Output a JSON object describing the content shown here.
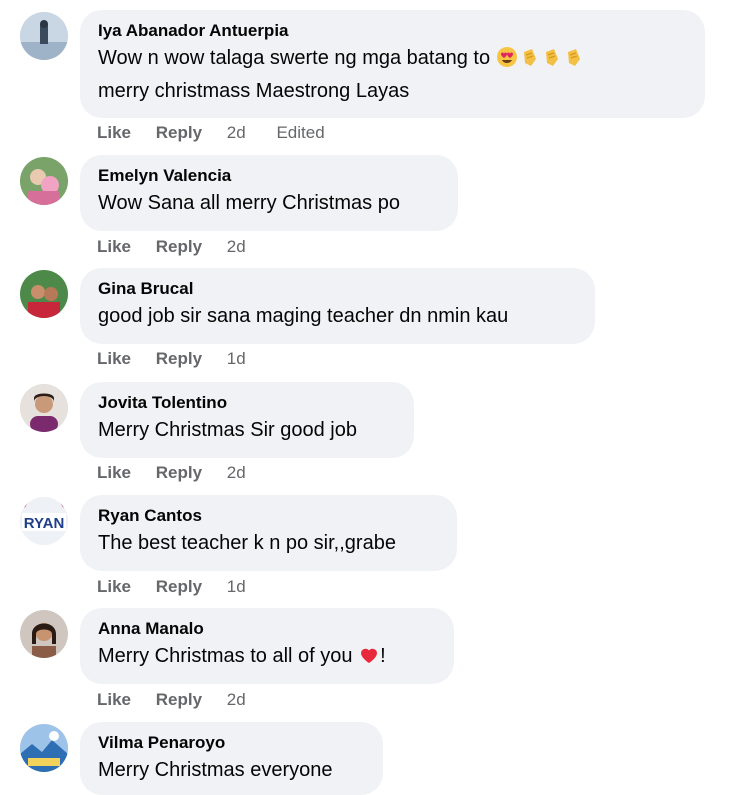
{
  "comments": [
    {
      "author": "Iya Abanador Antuerpia",
      "line1": "Wow n wow talaga swerte ng mga batang to",
      "line2": "merry christmass Maestrong Layas",
      "like": "Like",
      "reply": "Reply",
      "time": "2d",
      "edited": "Edited",
      "emojis": [
        "heart-eyes-emoji",
        "clapping-hands-emoji",
        "clapping-hands-emoji",
        "clapping-hands-emoji"
      ]
    },
    {
      "author": "Emelyn Valencia",
      "text": "Wow Sana all merry Christmas po",
      "like": "Like",
      "reply": "Reply",
      "time": "2d"
    },
    {
      "author": "Gina Brucal",
      "text": "good job sir sana maging teacher dn nmin kau",
      "like": "Like",
      "reply": "Reply",
      "time": "1d"
    },
    {
      "author": "Jovita Tolentino",
      "text": "Merry Christmas Sir good job",
      "like": "Like",
      "reply": "Reply",
      "time": "2d"
    },
    {
      "author": "Ryan Cantos",
      "avatar_text": "RYAN",
      "text": "The best teacher k n po sir,,grabe",
      "like": "Like",
      "reply": "Reply",
      "time": "1d"
    },
    {
      "author": "Anna Manalo",
      "text_before": "Merry Christmas to all of you",
      "text_after": "!",
      "emoji": "red-heart-emoji",
      "like": "Like",
      "reply": "Reply",
      "time": "2d"
    },
    {
      "author": "Vilma Penaroyo",
      "text": "Merry Christmas everyone"
    }
  ],
  "colors": {
    "bubble": "#f0f2f5",
    "meta_text": "#65676b",
    "body_text": "#050505"
  }
}
